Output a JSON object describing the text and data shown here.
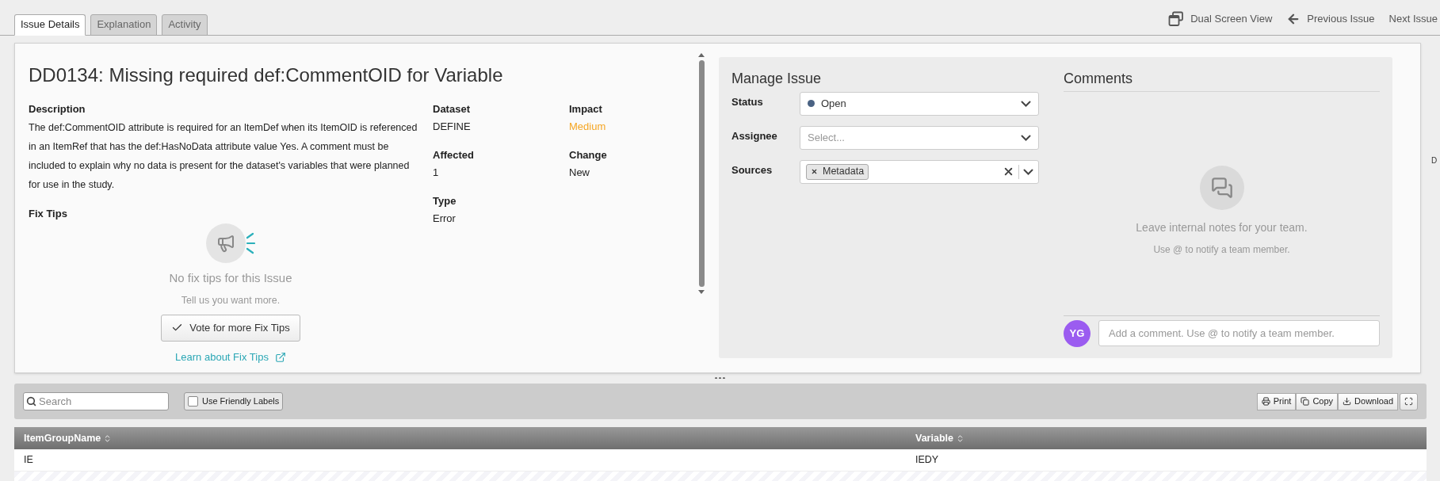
{
  "tabs": [
    {
      "label": "Issue Details",
      "selected": true
    },
    {
      "label": "Explanation",
      "selected": false
    },
    {
      "label": "Activity",
      "selected": false
    }
  ],
  "header_actions": [
    {
      "kind": "dual",
      "label": "Dual Screen View"
    },
    {
      "kind": "previous",
      "label": "Previous Issue"
    },
    {
      "kind": "next",
      "label": "Next Issue"
    }
  ],
  "issue": {
    "title": "DD0134: Missing required def:CommentOID for Variable",
    "description_label": "Description",
    "description": "The def:CommentOID attribute is required for an ItemDef when its ItemOID is referenced in an ItemRef that has the def:HasNoData attribute value Yes. A comment must be included to explain why no data is present for the dataset's variables that were planned for use in the study.",
    "fix_tips_label": "Fix Tips",
    "fix_tips": {
      "empty_title": "No fix tips for this Issue",
      "empty_hint": "Tell us you want more.",
      "vote_button": "Vote for more Fix Tips",
      "learn_link": "Learn about Fix Tips"
    },
    "fields": [
      {
        "label": "Dataset",
        "value": "DEFINE"
      },
      {
        "label": "Impact",
        "value": "Medium",
        "color": "#f5a623"
      },
      {
        "label": "Affected",
        "value": "1"
      },
      {
        "label": "Change",
        "value": "New"
      },
      {
        "label": "Type",
        "value": "Error"
      }
    ]
  },
  "manage": {
    "title": "Manage Issue",
    "status": {
      "label": "Status",
      "value": "Open",
      "color": "#4a6283"
    },
    "assignee": {
      "label": "Assignee",
      "placeholder": "Select..."
    },
    "sources": {
      "label": "Sources",
      "tags": [
        "Metadata"
      ]
    }
  },
  "comments": {
    "title": "Comments",
    "empty_title": "Leave internal notes for your team.",
    "empty_hint": "Use @ to notify a team member.",
    "avatar": "YG",
    "input_placeholder": "Add a comment. Use @ to notify a team member."
  },
  "edge_text": "D",
  "toolbar": {
    "search_placeholder": "Search",
    "friendly_labels": {
      "label": "Use Friendly Labels",
      "checked": false
    },
    "buttons": [
      {
        "kind": "print",
        "label": "Print"
      },
      {
        "kind": "copy",
        "label": "Copy"
      },
      {
        "kind": "download",
        "label": "Download"
      },
      {
        "kind": "fullscreen"
      }
    ]
  },
  "table": {
    "columns": [
      "ItemGroupName",
      "Variable"
    ],
    "rows": [
      [
        "IE",
        "IEDY"
      ]
    ]
  }
}
